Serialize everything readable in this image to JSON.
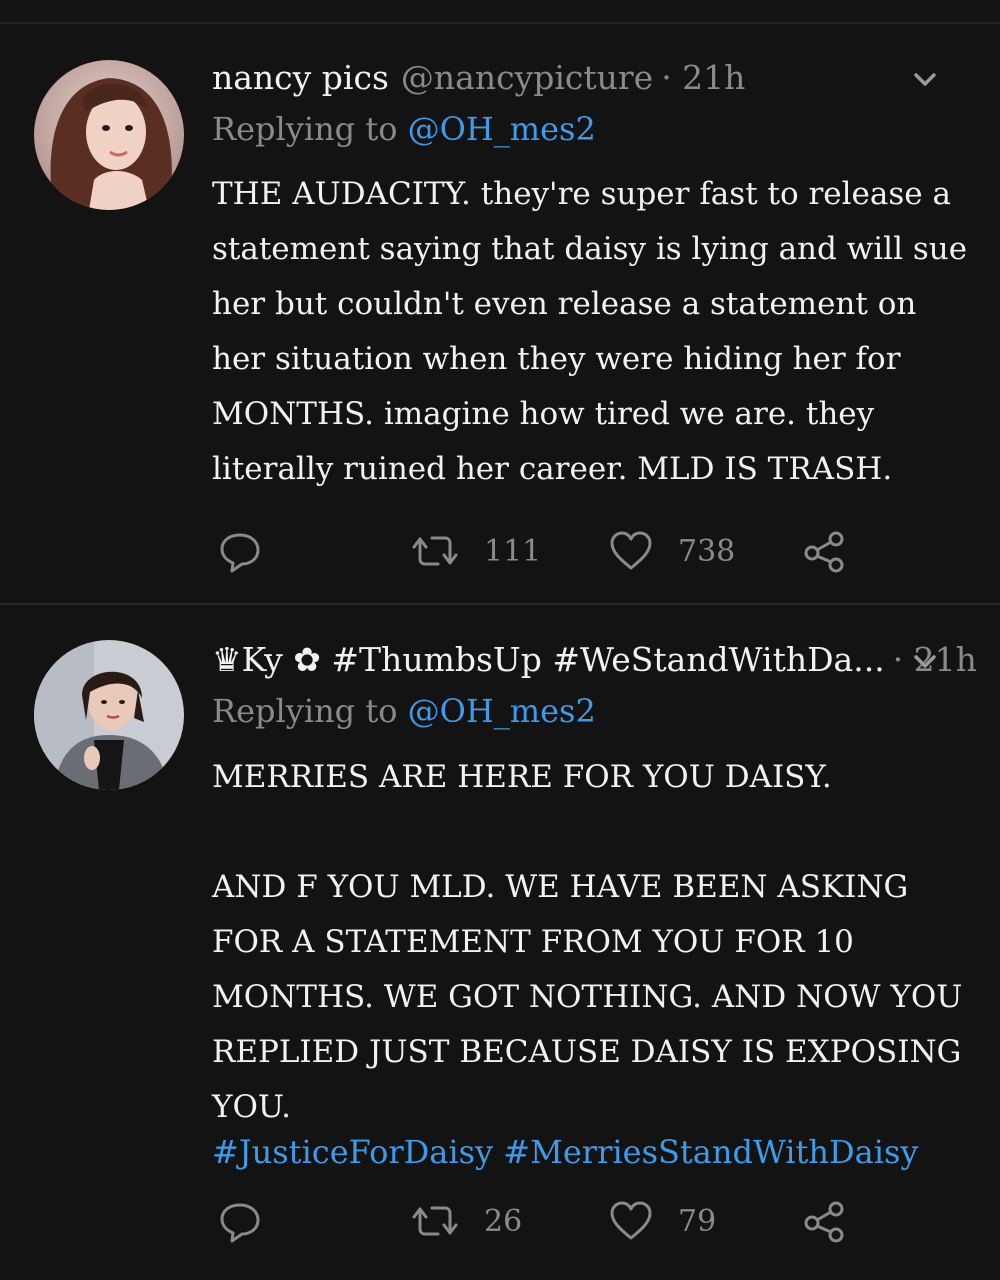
{
  "tweets": [
    {
      "display_name": "nancy pics",
      "handle": "@nancypicture",
      "time": "· 21h",
      "replying_prefix": "Replying to",
      "replying_to": "@OH_mes2",
      "text": "THE AUDACITY. they're super fast to release a statement saying that daisy is lying and will sue her but couldn't even release a statement on her situation when they were hiding her for MONTHS. imagine how tired we are. they literally ruined her career. MLD IS TRASH.",
      "retweets": "111",
      "likes": "738",
      "avatar_icon": "profile-photo"
    },
    {
      "display_name": "♛Ky ✿ #ThumbsUp #WeStandWithDa...",
      "handle": "",
      "time": "· 21h",
      "replying_prefix": "Replying to",
      "replying_to": "@OH_mes2",
      "text": "MERRIES ARE HERE FOR YOU DAISY.\n\nAND F YOU MLD. WE HAVE BEEN ASKING FOR A STATEMENT FROM YOU FOR 10 MONTHS. WE GOT NOTHING. AND NOW YOU REPLIED JUST BECAUSE DAISY IS EXPOSING YOU.",
      "hashtags": "#JusticeForDaisy #MerriesStandWithDaisy",
      "retweets": "26",
      "likes": "79",
      "avatar_icon": "profile-photo"
    }
  ],
  "colors": {
    "background": "#131313",
    "text": "#f2f2f2",
    "muted": "#8a8a8a",
    "link": "#3d9be9",
    "divider": "#2a2a2a"
  },
  "icons": [
    "reply-icon",
    "retweet-icon",
    "like-icon",
    "share-icon",
    "chevron-down-icon"
  ]
}
